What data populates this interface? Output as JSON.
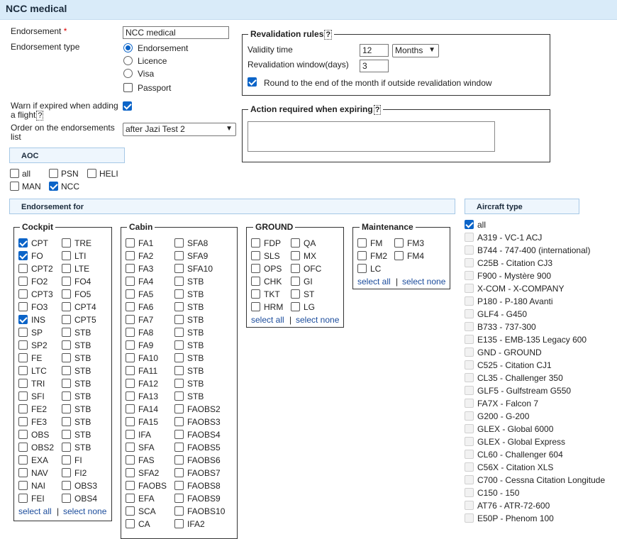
{
  "header": {
    "title": "NCC medical"
  },
  "form": {
    "endorsement_label": "Endorsement",
    "required_mark": "*",
    "endorsement_value": "NCC medical",
    "type_label": "Endorsement type",
    "types": [
      {
        "label": "Endorsement",
        "kind": "radio",
        "checked": true
      },
      {
        "label": "Licence",
        "kind": "radio",
        "checked": false
      },
      {
        "label": "Visa",
        "kind": "radio",
        "checked": false
      },
      {
        "label": "Passport",
        "kind": "checkbox",
        "checked": false
      }
    ],
    "warn_label_1": "Warn if expired when adding",
    "warn_label_2": "a flight",
    "warn_checked": true,
    "order_label_1": "Order on the endorsements",
    "order_label_2": "list",
    "order_value": "after Jazi Test 2"
  },
  "revalidation": {
    "legend": "Revalidation rules",
    "validity_label": "Validity time",
    "validity_value": "12",
    "validity_unit": "Months",
    "window_label": "Revalidation window(days)",
    "window_value": "3",
    "round_label": "Round to the end of the month if outside revalidation window",
    "round_checked": true
  },
  "action": {
    "legend": "Action required when expiring",
    "value": ""
  },
  "help_mark": "?",
  "aoc": {
    "header": "AOC",
    "items": [
      {
        "label": "all",
        "checked": false
      },
      {
        "label": "PSN",
        "checked": false
      },
      {
        "label": "HELI",
        "checked": false
      },
      {
        "label": "MAN",
        "checked": false
      },
      {
        "label": "NCC",
        "checked": true
      }
    ]
  },
  "endorsement_for": {
    "header": "Endorsement for"
  },
  "aircraft": {
    "header": "Aircraft type",
    "all": {
      "label": "all",
      "checked": true
    },
    "items": [
      "A319 - VC-1 ACJ",
      "B744 - 747-400 (international)",
      "C25B - Citation CJ3",
      "F900 - Mystère 900",
      "X-COM - X-COMPANY",
      "P180 - P-180 Avanti",
      "GLF4 - G450",
      "B733 - 737-300",
      "E135 - EMB-135 Legacy 600",
      "GND - GROUND",
      "C525 - Citation CJ1",
      "CL35 - Challenger 350",
      "GLF5 - Gulfstream G550",
      "FA7X - Falcon 7",
      "G200 - G-200",
      "GLEX - Global 6000",
      "GLEX - Global Express",
      "CL60 - Challenger 604",
      "C56X - Citation XLS",
      "C700 - Cessna Citation Longitude",
      "C150 - 150",
      "AT76 - ATR-72-600",
      "E50P - Phenom 100"
    ]
  },
  "links": {
    "select_all": "select all",
    "sep": "|",
    "select_none": "select none"
  },
  "groups": {
    "cockpit": {
      "legend": "Cockpit",
      "col1": [
        {
          "l": "CPT",
          "c": true
        },
        {
          "l": "FO",
          "c": true
        },
        {
          "l": "CPT2",
          "c": false
        },
        {
          "l": "FO2",
          "c": false
        },
        {
          "l": "CPT3",
          "c": false
        },
        {
          "l": "FO3",
          "c": false
        },
        {
          "l": "INS",
          "c": true
        },
        {
          "l": "SP",
          "c": false
        },
        {
          "l": "SP2",
          "c": false
        },
        {
          "l": "FE",
          "c": false
        },
        {
          "l": "LTC",
          "c": false
        },
        {
          "l": "TRI",
          "c": false
        },
        {
          "l": "SFI",
          "c": false
        },
        {
          "l": "FE2",
          "c": false
        },
        {
          "l": "FE3",
          "c": false
        },
        {
          "l": "OBS",
          "c": false
        },
        {
          "l": "OBS2",
          "c": false
        },
        {
          "l": "EXA",
          "c": false
        },
        {
          "l": "NAV",
          "c": false
        },
        {
          "l": "NAI",
          "c": false
        },
        {
          "l": "FEI",
          "c": false
        }
      ],
      "col2": [
        {
          "l": "TRE",
          "c": false
        },
        {
          "l": "LTI",
          "c": false
        },
        {
          "l": "LTE",
          "c": false
        },
        {
          "l": "FO4",
          "c": false
        },
        {
          "l": "FO5",
          "c": false
        },
        {
          "l": "CPT4",
          "c": false
        },
        {
          "l": "CPT5",
          "c": false
        },
        {
          "l": "STB",
          "c": false
        },
        {
          "l": "STB",
          "c": false
        },
        {
          "l": "STB",
          "c": false
        },
        {
          "l": "STB",
          "c": false
        },
        {
          "l": "STB",
          "c": false
        },
        {
          "l": "STB",
          "c": false
        },
        {
          "l": "STB",
          "c": false
        },
        {
          "l": "STB",
          "c": false
        },
        {
          "l": "STB",
          "c": false
        },
        {
          "l": "STB",
          "c": false
        },
        {
          "l": "FI",
          "c": false
        },
        {
          "l": "FI2",
          "c": false
        },
        {
          "l": "OBS3",
          "c": false
        },
        {
          "l": "OBS4",
          "c": false
        }
      ]
    },
    "cabin": {
      "legend": "Cabin",
      "col1": [
        {
          "l": "FA1",
          "c": false
        },
        {
          "l": "FA2",
          "c": false
        },
        {
          "l": "FA3",
          "c": false
        },
        {
          "l": "FA4",
          "c": false
        },
        {
          "l": "FA5",
          "c": false
        },
        {
          "l": "FA6",
          "c": false
        },
        {
          "l": "FA7",
          "c": false
        },
        {
          "l": "FA8",
          "c": false
        },
        {
          "l": "FA9",
          "c": false
        },
        {
          "l": "FA10",
          "c": false
        },
        {
          "l": "FA11",
          "c": false
        },
        {
          "l": "FA12",
          "c": false
        },
        {
          "l": "FA13",
          "c": false
        },
        {
          "l": "FA14",
          "c": false
        },
        {
          "l": "FA15",
          "c": false
        },
        {
          "l": "IFA",
          "c": false
        },
        {
          "l": "SFA",
          "c": false
        },
        {
          "l": "FAS",
          "c": false
        },
        {
          "l": "SFA2",
          "c": false
        },
        {
          "l": "FAOBS",
          "c": false
        },
        {
          "l": "EFA",
          "c": false
        },
        {
          "l": "SCA",
          "c": false
        },
        {
          "l": "CA",
          "c": false
        }
      ],
      "col2": [
        {
          "l": "SFA8",
          "c": false
        },
        {
          "l": "SFA9",
          "c": false
        },
        {
          "l": "SFA10",
          "c": false
        },
        {
          "l": "STB",
          "c": false
        },
        {
          "l": "STB",
          "c": false
        },
        {
          "l": "STB",
          "c": false
        },
        {
          "l": "STB",
          "c": false
        },
        {
          "l": "STB",
          "c": false
        },
        {
          "l": "STB",
          "c": false
        },
        {
          "l": "STB",
          "c": false
        },
        {
          "l": "STB",
          "c": false
        },
        {
          "l": "STB",
          "c": false
        },
        {
          "l": "STB",
          "c": false
        },
        {
          "l": "FAOBS2",
          "c": false
        },
        {
          "l": "FAOBS3",
          "c": false
        },
        {
          "l": "FAOBS4",
          "c": false
        },
        {
          "l": "FAOBS5",
          "c": false
        },
        {
          "l": "FAOBS6",
          "c": false
        },
        {
          "l": "FAOBS7",
          "c": false
        },
        {
          "l": "FAOBS8",
          "c": false
        },
        {
          "l": "FAOBS9",
          "c": false
        },
        {
          "l": "FAOBS10",
          "c": false
        },
        {
          "l": "IFA2",
          "c": false
        }
      ]
    },
    "ground": {
      "legend": "GROUND",
      "col1": [
        {
          "l": "FDP",
          "c": false
        },
        {
          "l": "SLS",
          "c": false
        },
        {
          "l": "OPS",
          "c": false
        },
        {
          "l": "CHK",
          "c": false
        },
        {
          "l": "TKT",
          "c": false
        },
        {
          "l": "HRM",
          "c": false
        }
      ],
      "col2": [
        {
          "l": "QA",
          "c": false
        },
        {
          "l": "MX",
          "c": false
        },
        {
          "l": "OFC",
          "c": false
        },
        {
          "l": "GI",
          "c": false
        },
        {
          "l": "ST",
          "c": false
        },
        {
          "l": "LG",
          "c": false
        }
      ]
    },
    "maint": {
      "legend": "Maintenance",
      "col1": [
        {
          "l": "FM",
          "c": false
        },
        {
          "l": "FM2",
          "c": false
        },
        {
          "l": "LC",
          "c": false
        }
      ],
      "col2": [
        {
          "l": "FM3",
          "c": false
        },
        {
          "l": "FM4",
          "c": false
        }
      ]
    }
  }
}
